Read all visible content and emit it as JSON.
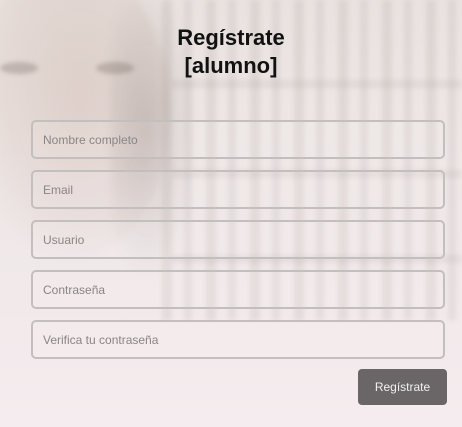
{
  "form": {
    "title_line1": "Regístrate",
    "title_line2": "[alumno]",
    "fields": [
      {
        "placeholder": "Nombre completo",
        "value": ""
      },
      {
        "placeholder": "Email",
        "value": ""
      },
      {
        "placeholder": "Usuario",
        "value": ""
      },
      {
        "placeholder": "Contraseña",
        "value": ""
      },
      {
        "placeholder": "Verifica tu contraseña",
        "value": ""
      }
    ],
    "submit_label": "Regístrate"
  },
  "colors": {
    "button_bg": "#6a6667",
    "field_border": "#c3bfbf",
    "title": "#111111"
  }
}
